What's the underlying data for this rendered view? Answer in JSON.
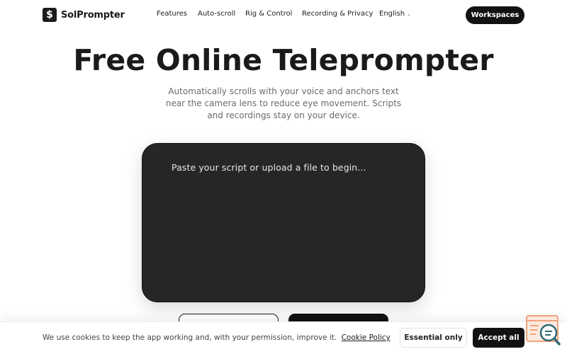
{
  "header": {
    "brand": "SolPrompter",
    "logo_glyph": "$",
    "nav": [
      "Features",
      "Auto-scroll",
      "Rig & Control",
      "Recording & Privacy"
    ],
    "language": "English",
    "cta": "Workspaces"
  },
  "hero": {
    "title": "Free Online Teleprompter",
    "subtitle": "Automatically scrolls with your voice and anchors text near the camera lens to reduce eye movement. Scripts and recordings stay on your device."
  },
  "prompter": {
    "placeholder": "Paste your script or upload a file to begin..."
  },
  "cookie": {
    "message": "We use cookies to keep the app working and, with your permission, improve it.",
    "link": "Cookie Policy",
    "essential": "Essential only",
    "accept": "Accept all"
  },
  "colors": {
    "primary": "#121212",
    "prompter_bg": "#262628",
    "widget_accent": "#f0a37a",
    "widget_teal": "#2d6a73"
  },
  "icons": {
    "logo": "dollar-icon",
    "language_chevron": "chevron-down-icon",
    "widget": "search-chat-icon"
  }
}
